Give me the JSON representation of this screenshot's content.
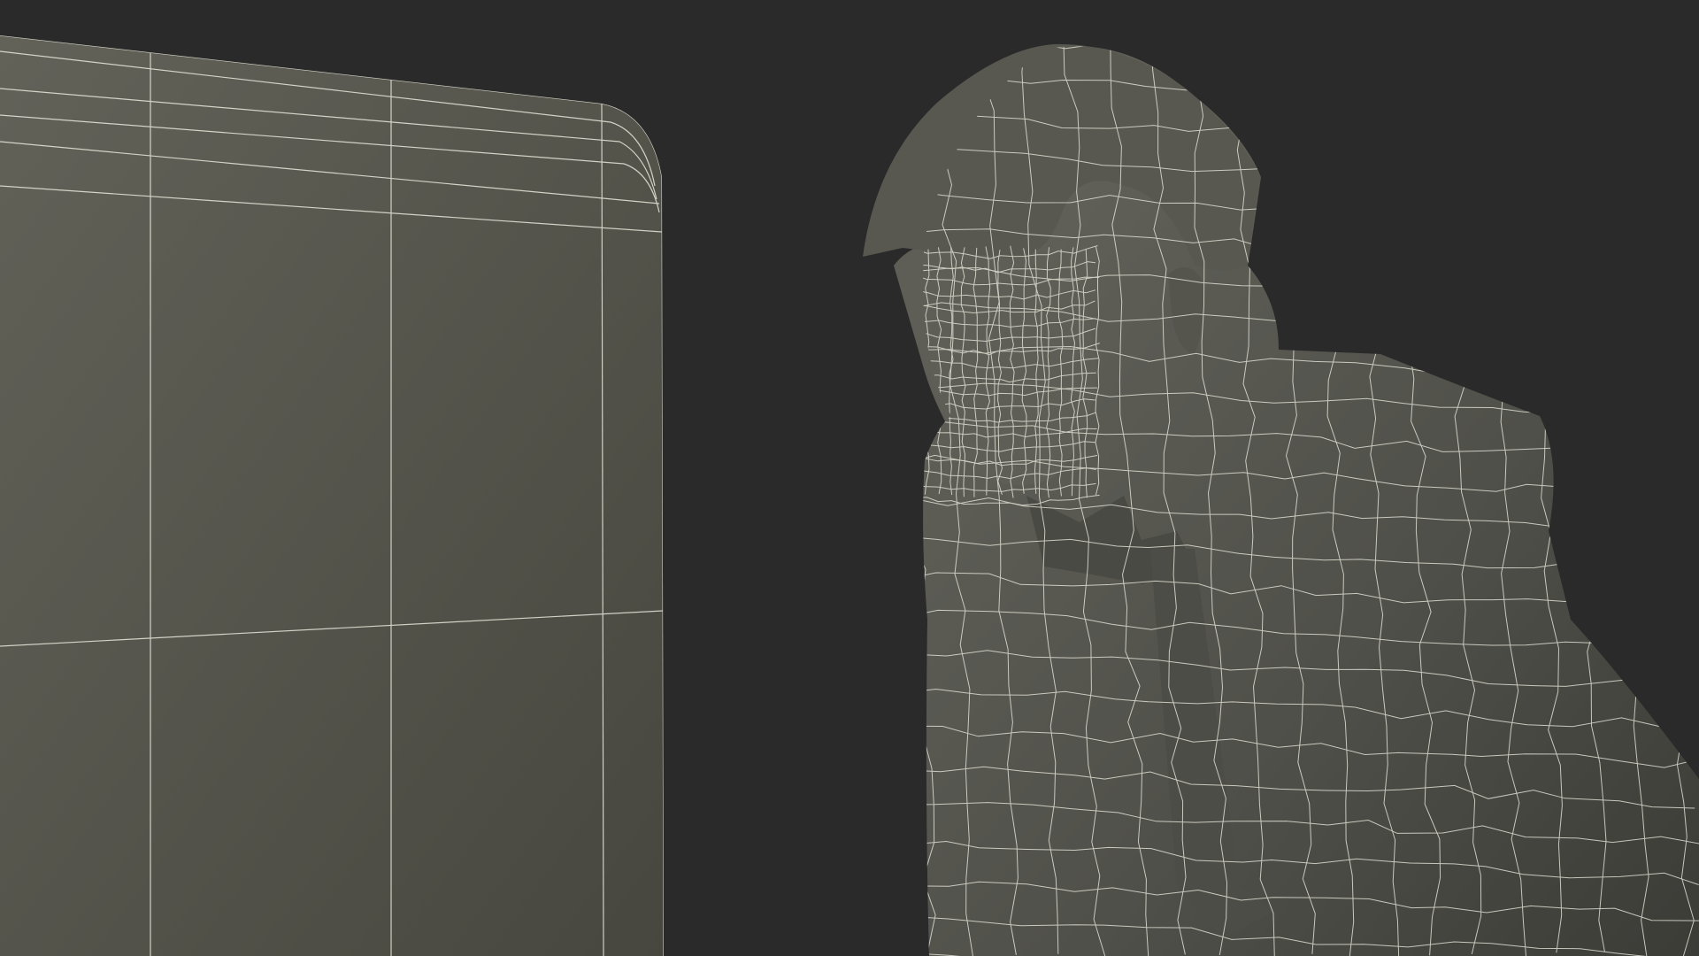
{
  "scene": {
    "background_color": "#2a2a2a",
    "mesh_fill_color": "#5a5a53",
    "mesh_shadow_color": "#3f3f3a",
    "wire_color": "#e8e8dc",
    "objects": [
      "monitor-panel",
      "person-figure"
    ]
  }
}
